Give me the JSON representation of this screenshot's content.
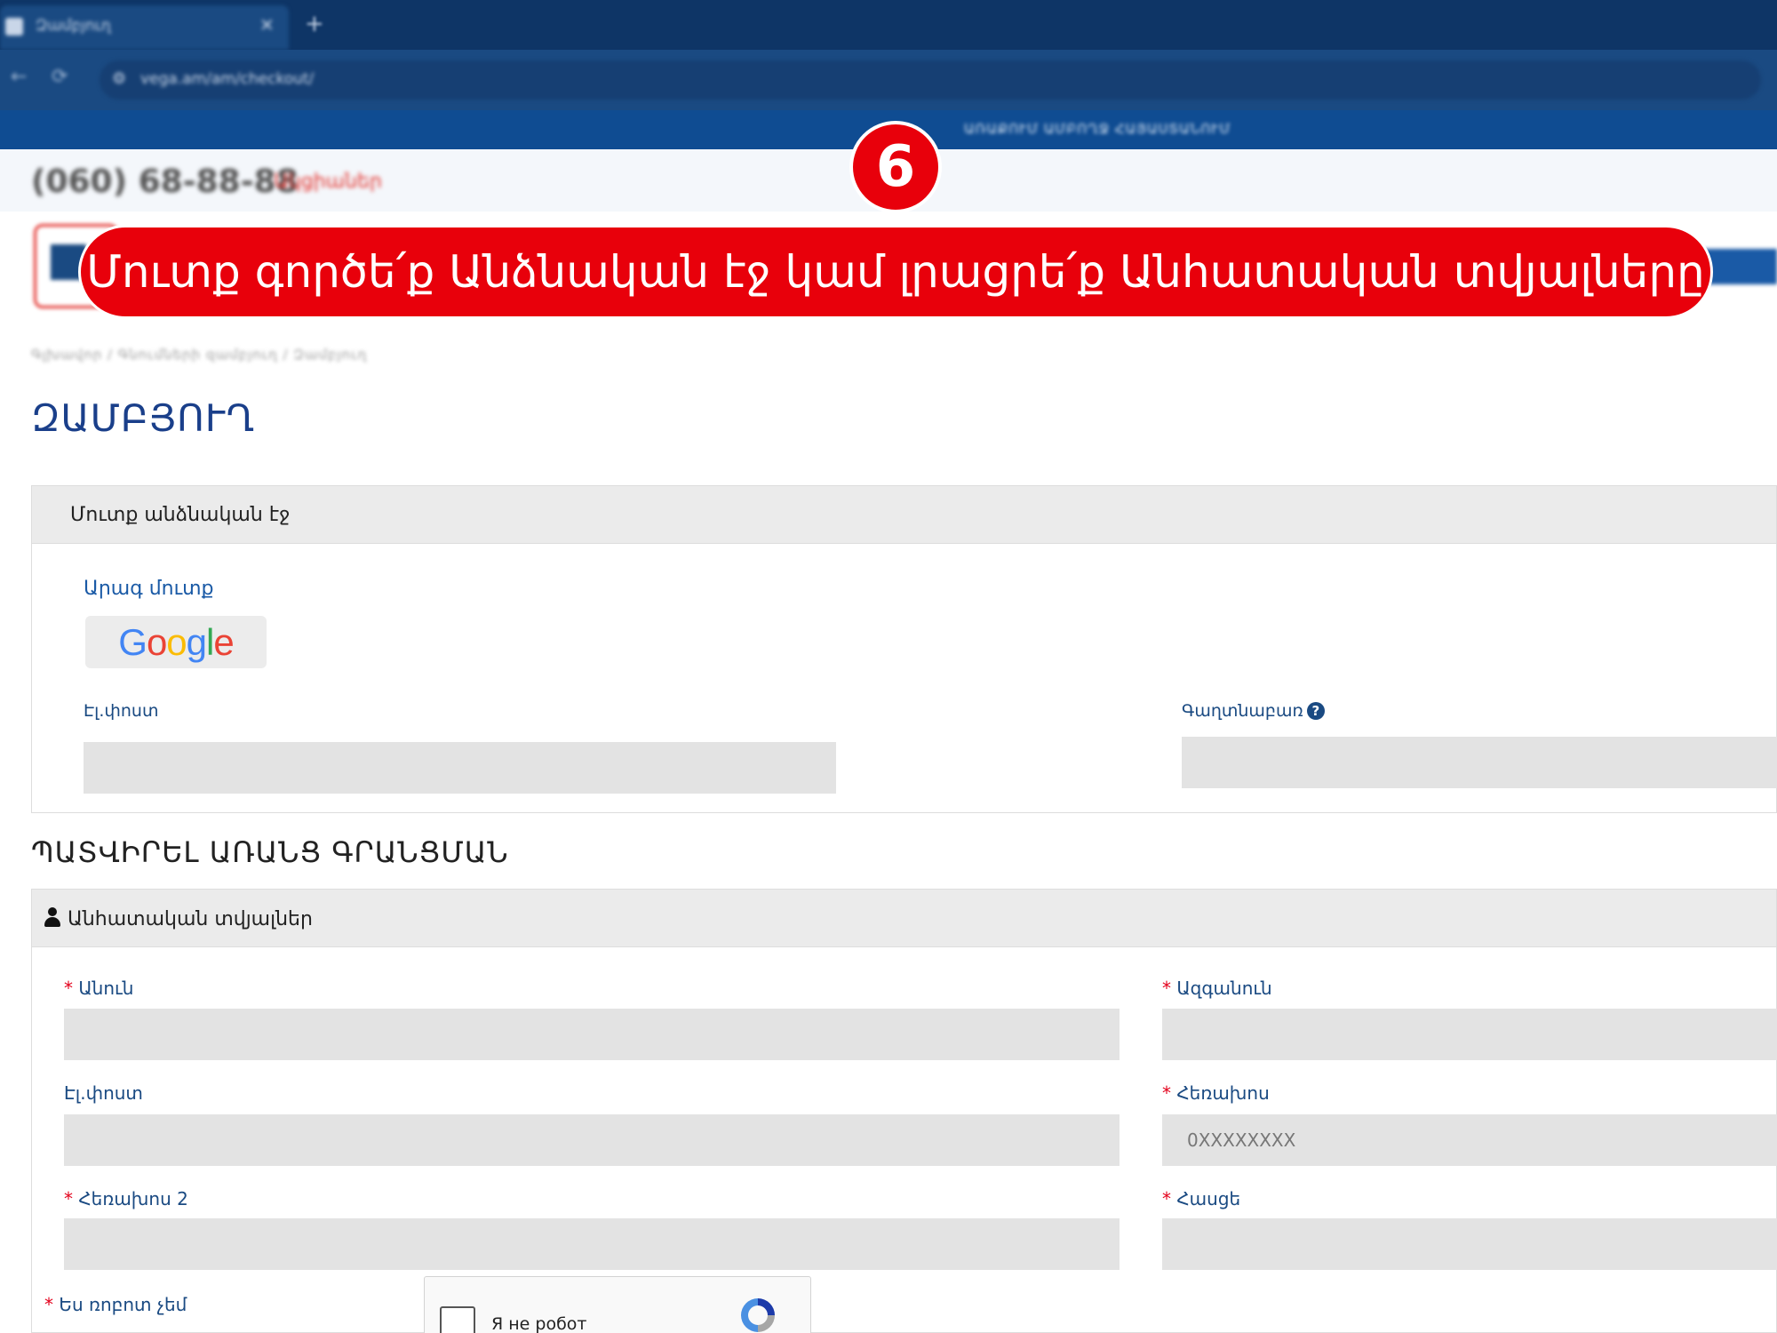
{
  "browser": {
    "tab_title": "Զամբյուղ",
    "tab_close": "✕",
    "new_tab": "+",
    "url": "vega.am/am/checkout/",
    "back": "←",
    "reload": "⟳"
  },
  "site": {
    "promo": "ԱՌԱՔՈՒՄ ԱՄԲՈՂՋ ՀԱՅԱՍՏԱՆՈՒՄ",
    "phone": "(060) 68-88-88",
    "red_link": "Ակցիաներ",
    "breadcrumb": "Գլխավոր / Գնումների զամբյուղ / Զամբյուղ"
  },
  "annotation": {
    "step_number": "6",
    "banner_text": "Մուտք գործե՛ք Անձնական էջ կամ լրացրե՛ք Անհատական տվյալները"
  },
  "page": {
    "title": "ԶԱՄԲՅՈՒՂ"
  },
  "login_panel": {
    "header": "Մուտք անձնական էջ",
    "quick_login": "Արագ մուտք",
    "google": [
      "G",
      "o",
      "o",
      "g",
      "l",
      "e"
    ],
    "email_label": "Էլ.փոստ",
    "password_label": "Գաղտնաբառ",
    "help_icon": "?"
  },
  "guest_section": {
    "title": "ՊԱՏՎԻՐԵԼ ԱՌԱՆՑ ԳՐԱՆՑՄԱՆ"
  },
  "personal_panel": {
    "header": "Անհատական տվյալներ",
    "required_mark": "*",
    "first_name_label": "Անուն",
    "last_name_label": "Ազգանուն",
    "email_label": "Էլ.փոստ",
    "phone_label": "Հեռախոս",
    "phone_placeholder": "0XXXXXXXX",
    "phone2_label": "Հեռախոս 2",
    "address_label": "Հասցե",
    "robot_label": "Ես ռոբոտ չեմ",
    "captcha_text": "Я не робот"
  },
  "colors": {
    "accent_blue": "#1a4a82",
    "title_blue": "#1a3f8a",
    "annotation_red": "#e8000b",
    "required_red": "#e3001b",
    "google_blue": "#4285F4",
    "google_red": "#EA4335",
    "google_yellow": "#FBBC05",
    "google_green": "#34A853"
  }
}
